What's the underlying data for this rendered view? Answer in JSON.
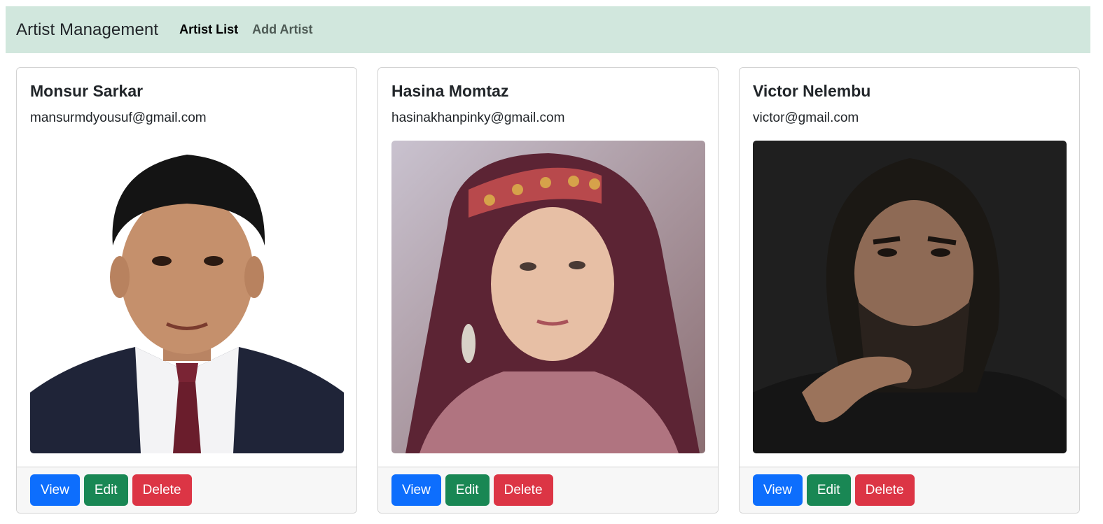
{
  "navbar": {
    "brand": "Artist Management",
    "links": [
      "Artist List",
      "Add Artist"
    ]
  },
  "artists": [
    {
      "name": "Monsur Sarkar",
      "email": "mansurmdyousuf@gmail.com",
      "photo": "portrait-man-suit"
    },
    {
      "name": "Hasina Momtaz",
      "email": "hasinakhanpinky@gmail.com",
      "photo": "portrait-woman-headdress"
    },
    {
      "name": "Victor Nelembu",
      "email": "victor@gmail.com",
      "photo": "portrait-man-beard"
    }
  ],
  "buttons": {
    "view": "View",
    "edit": "Edit",
    "delete": "Delete"
  },
  "colors": {
    "navbar_bg": "#d1e7dd",
    "view": "#0d6efd",
    "edit": "#198754",
    "delete": "#dc3545"
  }
}
